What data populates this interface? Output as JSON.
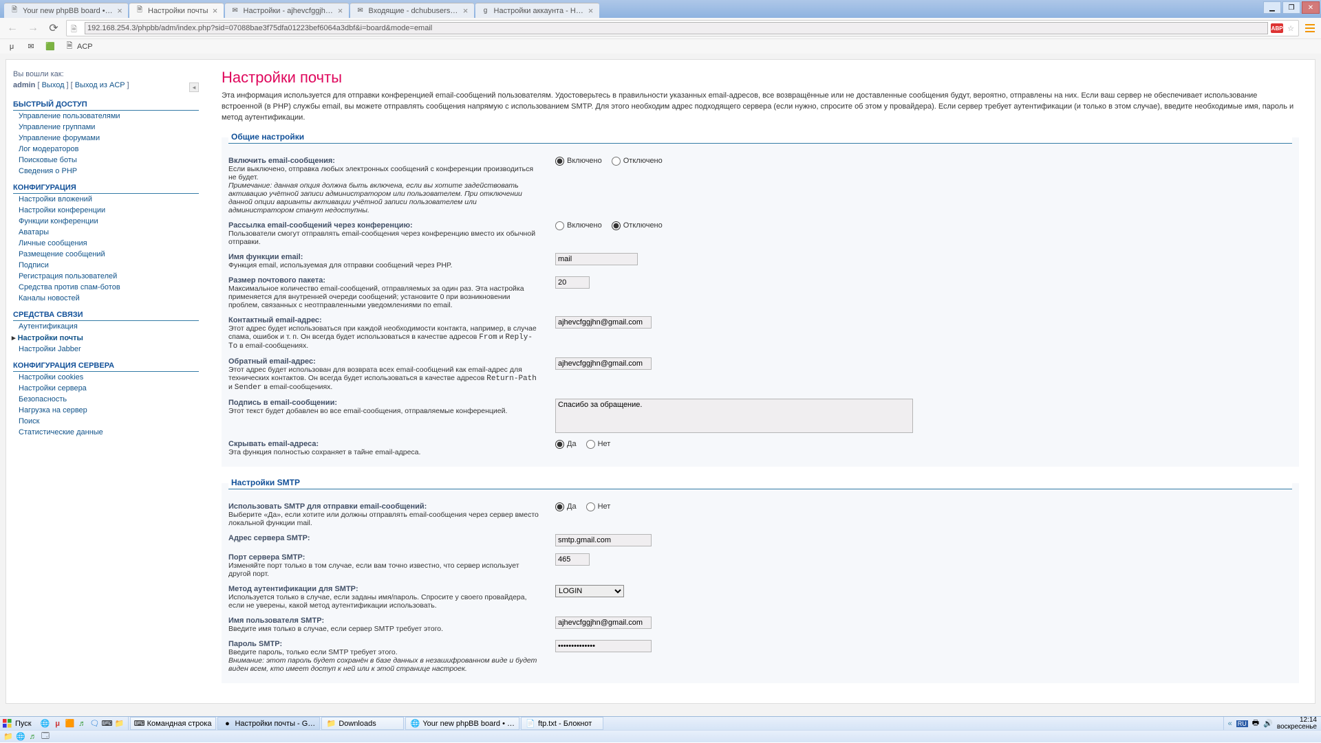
{
  "browser": {
    "tabs": [
      {
        "title": "Your new phpBB board • Ли…",
        "favicon": "🗎"
      },
      {
        "title": "Настройки почты",
        "favicon": "🗎",
        "active": true
      },
      {
        "title": "Настройки - ajhevcfggjhn@…",
        "favicon": "✉"
      },
      {
        "title": "Входящие - dchubusers@g…",
        "favicon": "✉"
      },
      {
        "title": "Настройки аккаунта - Нас…",
        "favicon": "g"
      }
    ],
    "url": "192.168.254.3/phpbb/adm/index.php?sid=07088bae3f75dfa01223bef6064a3dbf&i=board&mode=email",
    "bookmarks": [
      {
        "label": "",
        "icon": "μ"
      },
      {
        "label": "",
        "icon": "✉"
      },
      {
        "label": "",
        "icon": "🟩"
      },
      {
        "label": "ACP",
        "icon": "🗎"
      }
    ]
  },
  "sidebar": {
    "login_label": "Вы вошли как:",
    "username": "admin",
    "logout": "Выход",
    "logout_acp": "Выход из ACP",
    "sections": [
      {
        "title": "БЫСТРЫЙ ДОСТУП",
        "items": [
          "Управление пользователями",
          "Управление группами",
          "Управление форумами",
          "Лог модераторов",
          "Поисковые боты",
          "Сведения о PHP"
        ]
      },
      {
        "title": "КОНФИГУРАЦИЯ",
        "items": [
          "Настройки вложений",
          "Настройки конференции",
          "Функции конференции",
          "Аватары",
          "Личные сообщения",
          "Размещение сообщений",
          "Подписи",
          "Регистрация пользователей",
          "Средства против спам-ботов",
          "Каналы новостей"
        ]
      },
      {
        "title": "СРЕДСТВА СВЯЗИ",
        "items": [
          "Аутентификация",
          "Настройки почты",
          "Настройки Jabber"
        ],
        "active_index": 1
      },
      {
        "title": "КОНФИГУРАЦИЯ СЕРВЕРА",
        "items": [
          "Настройки cookies",
          "Настройки сервера",
          "Безопасность",
          "Нагрузка на сервер",
          "Поиск",
          "Статистические данные"
        ]
      }
    ]
  },
  "page": {
    "title": "Настройки почты",
    "intro": "Эта информация используется для отправки конференцией email-сообщений пользователям. Удостоверьтесь в правильности указанных email-адресов, все возвращённые или не доставленные сообщения будут, вероятно, отправлены на них. Если ваш сервер не обеспечивает использование встроенной (в PHP) службы email, вы можете отправлять сообщения напрямую с использованием SMTP. Для этого необходим адрес подходящего сервера (если нужно, спросите об этом у провайдера). Если сервер требует аутентификации (и только в этом случае), введите необходимые имя, пароль и метод аутентификации."
  },
  "fs1": {
    "legend": "Общие настройки",
    "r1": {
      "label": "Включить email-сообщения:",
      "desc": "Если выключено, отправка любых электронных сообщений с конференции производиться не будет.",
      "note": "Примечание: данная опция должна быть включена, если вы хотите задействовать активацию учётной записи администратором или пользователем. При отключении данной опции варианты активации учётной записи пользователем или администратором станут недоступны.",
      "on": "Включено",
      "off": "Отключено",
      "value": "on"
    },
    "r2": {
      "label": "Рассылка email-сообщений через конференцию:",
      "desc": "Пользователи смогут отправлять email-сообщения через конференцию вместо их обычной отправки.",
      "on": "Включено",
      "off": "Отключено",
      "value": "off"
    },
    "r3": {
      "label": "Имя функции email:",
      "desc": "Функция email, используемая для отправки сообщений через PHP.",
      "value": "mail"
    },
    "r4": {
      "label": "Размер почтового пакета:",
      "desc": "Максимальное количество email-сообщений, отправляемых за один раз. Эта настройка применяется для внутренней очереди сообщений; установите 0 при возникновении проблем, связанных с неотправленными уведомлениями по email.",
      "value": "20"
    },
    "r5": {
      "label": "Контактный email-адрес:",
      "desc": "Этот адрес будет использоваться при каждой необходимости контакта, например, в случае спама, ошибок и т. п. Он всегда будет использоваться в качестве адресов From и Reply-To в email-сообщениях.",
      "value": "ajhevcfggjhn@gmail.com"
    },
    "r6": {
      "label": "Обратный email-адрес:",
      "desc": "Этот адрес будет использован для возврата всех email-сообщений как email-адрес для технических контактов. Он всегда будет использоваться в качестве адресов Return-Path и Sender в email-сообщениях.",
      "value": "ajhevcfggjhn@gmail.com"
    },
    "r7": {
      "label": "Подпись в email-сообщении:",
      "desc": "Этот текст будет добавлен во все email-сообщения, отправляемые конференцией.",
      "value": "Спасибо за обращение."
    },
    "r8": {
      "label": "Скрывать email-адреса:",
      "desc": "Эта функция полностью сохраняет в тайне email-адреса.",
      "yes": "Да",
      "no": "Нет",
      "value": "yes"
    }
  },
  "fs2": {
    "legend": "Настройки SMTP",
    "r1": {
      "label": "Использовать SMTP для отправки email-сообщений:",
      "desc": "Выберите «Да», если хотите или должны отправлять email-сообщения через сервер вместо локальной функции mail.",
      "yes": "Да",
      "no": "Нет",
      "value": "yes"
    },
    "r2": {
      "label": "Адрес сервера SMTP:",
      "value": "smtp.gmail.com"
    },
    "r3": {
      "label": "Порт сервера SMTP:",
      "desc": "Изменяйте порт только в том случае, если вам точно известно, что сервер использует другой порт.",
      "value": "465"
    },
    "r4": {
      "label": "Метод аутентификации для SMTP:",
      "desc": "Используется только в случае, если заданы имя/пароль. Спросите у своего провайдера, если не уверены, какой метод аутентификации использовать.",
      "value": "LOGIN"
    },
    "r5": {
      "label": "Имя пользователя SMTP:",
      "desc": "Введите имя только в случае, если сервер SMTP требует этого.",
      "value": "ajhevcfggjhn@gmail.com"
    },
    "r6": {
      "label": "Пароль SMTP:",
      "desc": "Введите пароль, только если SMTP требует этого.",
      "warn": "Внимание: этот пароль будет сохранён в базе данных в незашифрованном виде и будет виден всем, кто имеет доступ к ней или к этой странице настроек.",
      "value": "••••••••••••••"
    }
  },
  "taskbar": {
    "start": "Пуск",
    "tasks": [
      {
        "label": "Командная строка",
        "icon": "⌨"
      },
      {
        "label": "Настройки почты - G…",
        "icon": "●",
        "active": true
      },
      {
        "label": "Downloads",
        "icon": "📁"
      },
      {
        "label": "Your new phpBB board • …",
        "icon": "🌐"
      },
      {
        "label": "ftp.txt - Блокнот",
        "icon": "📄"
      }
    ],
    "clock_time": "12:14",
    "clock_day": "воскресенье",
    "lang": "RU"
  }
}
